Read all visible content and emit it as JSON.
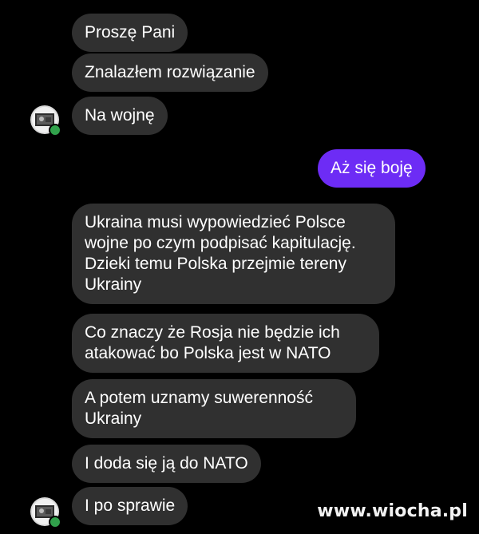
{
  "messages": [
    {
      "text": "Proszę Pani",
      "direction": "incoming"
    },
    {
      "text": "Znalazłem rozwiązanie",
      "direction": "incoming"
    },
    {
      "text": "Na wojnę",
      "direction": "incoming"
    },
    {
      "text": "Aż się boję",
      "direction": "outgoing"
    },
    {
      "text": "Ukraina musi wypowiedzieć Polsce wojne po czym podpisać kapitulację. Dzieki temu Polska przejmie tereny Ukrainy",
      "direction": "incoming"
    },
    {
      "text": "Co znaczy że Rosja nie będzie ich atakować bo Polska jest w NATO",
      "direction": "incoming"
    },
    {
      "text": "A potem uznamy suwerenność Ukrainy",
      "direction": "incoming"
    },
    {
      "text": "I doda się ją do NATO",
      "direction": "incoming"
    },
    {
      "text": "I po sprawie",
      "direction": "incoming"
    }
  ],
  "avatars": [
    {
      "icon": "contact-avatar",
      "status": "online"
    },
    {
      "icon": "contact-avatar",
      "status": "online"
    }
  ],
  "watermark": "www.wiocha.pl",
  "colors": {
    "background": "#000000",
    "incoming_bubble": "#303030",
    "outgoing_bubble": "#6d2cf5",
    "text": "#ffffff",
    "online_dot": "#31a24c"
  }
}
